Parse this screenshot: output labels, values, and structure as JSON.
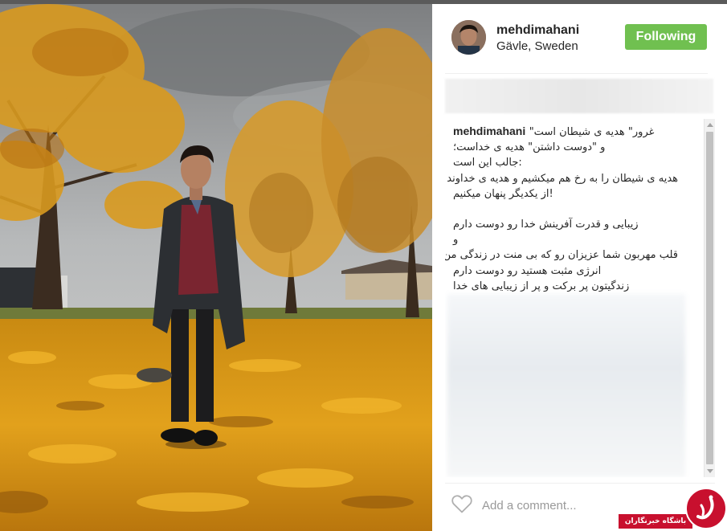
{
  "post": {
    "username": "mehdimahani",
    "location": "Gävle, Sweden",
    "follow_label": "Following"
  },
  "caption": {
    "username": "mehdimahani",
    "lines": [
      "غرور\" هدیه ی شیطان است\"",
      "و \"دوست داشتن\" هدیه ی خداست؛",
      ":جالب این است",
      "هدیه ی شیطان را به رخ هم میکشیم و هدیه ی خداوند را",
      "!از یکدیگر پنهان میکنیم",
      "",
      "زیبایی و قدرت آفرینش خدا رو دوست دارم",
      "و",
      "قلب مهربون شما عزیزان رو که بی منت در زندگی من",
      "انرژی مثبت هستید رو دوست دارم",
      "زندگیتون پر برکت و پر از زیبایی های خدا"
    ]
  },
  "comment": {
    "placeholder": "Add a comment..."
  },
  "watermark": {
    "text": "باشگاه خبرنگاران"
  },
  "colors": {
    "follow_button": "#70c050",
    "watermark_red": "#c8102e",
    "text": "#262626",
    "placeholder": "#999999"
  },
  "icons": {
    "like": "heart-outline-icon",
    "scroll_up": "arrow-up-icon",
    "scroll_down": "arrow-down-icon"
  }
}
